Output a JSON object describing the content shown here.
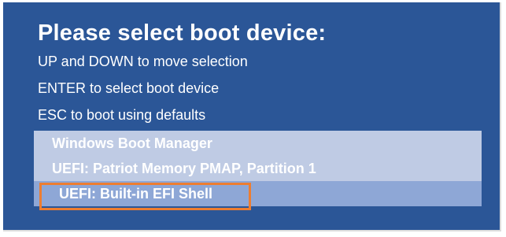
{
  "boot_menu": {
    "title": "Please select boot device:",
    "instructions": [
      "UP and DOWN to move selection",
      "ENTER to select boot device",
      "ESC to boot using defaults"
    ],
    "devices": [
      {
        "label": "Windows Boot Manager",
        "selected": false
      },
      {
        "label": "UEFI: Patriot Memory PMAP, Partition 1",
        "selected": false
      },
      {
        "label": "UEFI: Built-in EFI Shell",
        "selected": true
      }
    ]
  },
  "colors": {
    "background": "#2b5697",
    "menu_background": "#bfcbe4",
    "selected_background": "#8ea7d6",
    "highlight_outline": "#ed7d31",
    "text": "#ffffff"
  }
}
